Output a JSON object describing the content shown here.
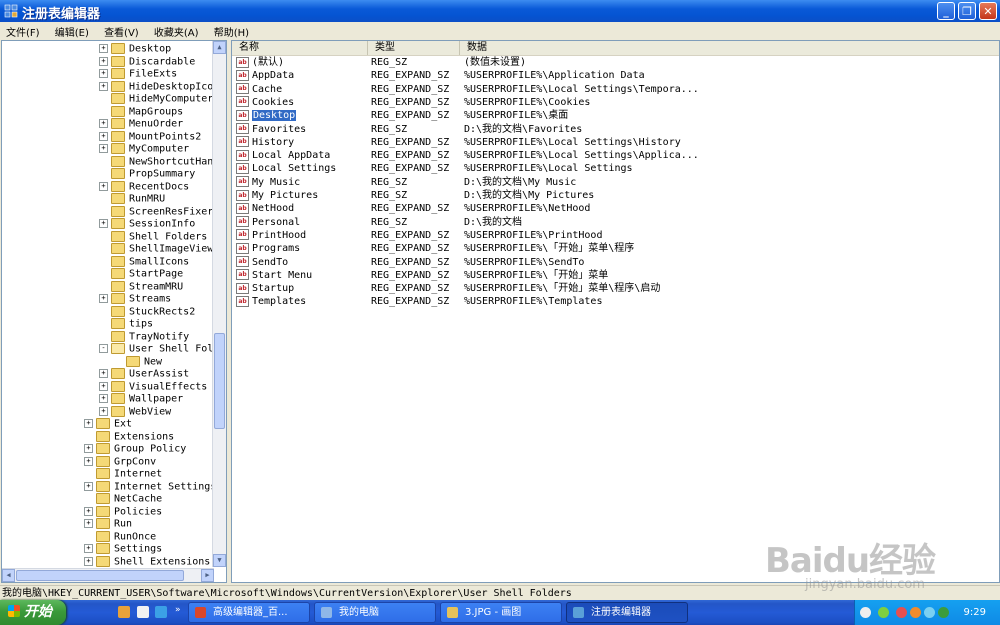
{
  "window": {
    "title": "注册表编辑器"
  },
  "menu": [
    "文件(F)",
    "编辑(E)",
    "查看(V)",
    "收藏夹(A)",
    "帮助(H)"
  ],
  "tree": {
    "items": [
      {
        "label": "Desktop",
        "level": 2,
        "expander": "+"
      },
      {
        "label": "Discardable",
        "level": 2,
        "expander": "+"
      },
      {
        "label": "FileExts",
        "level": 2,
        "expander": "+"
      },
      {
        "label": "HideDesktopIcons",
        "level": 2,
        "expander": "+"
      },
      {
        "label": "HideMyComputerIcons",
        "level": 2,
        "expander": ""
      },
      {
        "label": "MapGroups",
        "level": 2,
        "expander": ""
      },
      {
        "label": "MenuOrder",
        "level": 2,
        "expander": "+"
      },
      {
        "label": "MountPoints2",
        "level": 2,
        "expander": "+"
      },
      {
        "label": "MyComputer",
        "level": 2,
        "expander": "+"
      },
      {
        "label": "NewShortcutHandlers",
        "level": 2,
        "expander": ""
      },
      {
        "label": "PropSummary",
        "level": 2,
        "expander": ""
      },
      {
        "label": "RecentDocs",
        "level": 2,
        "expander": "+"
      },
      {
        "label": "RunMRU",
        "level": 2,
        "expander": ""
      },
      {
        "label": "ScreenResFixer",
        "level": 2,
        "expander": ""
      },
      {
        "label": "SessionInfo",
        "level": 2,
        "expander": "+"
      },
      {
        "label": "Shell Folders",
        "level": 2,
        "expander": ""
      },
      {
        "label": "ShellImageView",
        "level": 2,
        "expander": ""
      },
      {
        "label": "SmallIcons",
        "level": 2,
        "expander": ""
      },
      {
        "label": "StartPage",
        "level": 2,
        "expander": ""
      },
      {
        "label": "StreamMRU",
        "level": 2,
        "expander": ""
      },
      {
        "label": "Streams",
        "level": 2,
        "expander": "+"
      },
      {
        "label": "StuckRects2",
        "level": 2,
        "expander": ""
      },
      {
        "label": "tips",
        "level": 2,
        "expander": ""
      },
      {
        "label": "TrayNotify",
        "level": 2,
        "expander": ""
      },
      {
        "label": "User Shell Folders",
        "level": 2,
        "expander": "-",
        "open": true
      },
      {
        "label": "New",
        "level": 3,
        "expander": ""
      },
      {
        "label": "UserAssist",
        "level": 2,
        "expander": "+"
      },
      {
        "label": "VisualEffects",
        "level": 2,
        "expander": "+"
      },
      {
        "label": "Wallpaper",
        "level": 2,
        "expander": "+"
      },
      {
        "label": "WebView",
        "level": 2,
        "expander": "+"
      },
      {
        "label": "Ext",
        "level": 1,
        "expander": "+"
      },
      {
        "label": "Extensions",
        "level": 1,
        "expander": ""
      },
      {
        "label": "Group Policy",
        "level": 1,
        "expander": "+"
      },
      {
        "label": "GrpConv",
        "level": 1,
        "expander": "+"
      },
      {
        "label": "Internet",
        "level": 1,
        "expander": ""
      },
      {
        "label": "Internet Settings",
        "level": 1,
        "expander": "+"
      },
      {
        "label": "NetCache",
        "level": 1,
        "expander": ""
      },
      {
        "label": "Policies",
        "level": 1,
        "expander": "+"
      },
      {
        "label": "Run",
        "level": 1,
        "expander": "+"
      },
      {
        "label": "RunOnce",
        "level": 1,
        "expander": ""
      },
      {
        "label": "Settings",
        "level": 1,
        "expander": "+"
      },
      {
        "label": "Shell Extensions",
        "level": 1,
        "expander": "+"
      }
    ]
  },
  "list": {
    "columns": [
      "名称",
      "类型",
      "数据"
    ],
    "rows": [
      {
        "name": "(默认)",
        "type": "REG_SZ",
        "data": "(数值未设置)"
      },
      {
        "name": "AppData",
        "type": "REG_EXPAND_SZ",
        "data": "%USERPROFILE%\\Application Data"
      },
      {
        "name": "Cache",
        "type": "REG_EXPAND_SZ",
        "data": "%USERPROFILE%\\Local Settings\\Tempora..."
      },
      {
        "name": "Cookies",
        "type": "REG_EXPAND_SZ",
        "data": "%USERPROFILE%\\Cookies"
      },
      {
        "name": "Desktop",
        "type": "REG_EXPAND_SZ",
        "data": "%USERPROFILE%\\桌面",
        "selected": true
      },
      {
        "name": "Favorites",
        "type": "REG_SZ",
        "data": "D:\\我的文档\\Favorites"
      },
      {
        "name": "History",
        "type": "REG_EXPAND_SZ",
        "data": "%USERPROFILE%\\Local Settings\\History"
      },
      {
        "name": "Local AppData",
        "type": "REG_EXPAND_SZ",
        "data": "%USERPROFILE%\\Local Settings\\Applica..."
      },
      {
        "name": "Local Settings",
        "type": "REG_EXPAND_SZ",
        "data": "%USERPROFILE%\\Local Settings"
      },
      {
        "name": "My Music",
        "type": "REG_SZ",
        "data": "D:\\我的文档\\My Music"
      },
      {
        "name": "My Pictures",
        "type": "REG_SZ",
        "data": "D:\\我的文档\\My Pictures"
      },
      {
        "name": "NetHood",
        "type": "REG_EXPAND_SZ",
        "data": "%USERPROFILE%\\NetHood"
      },
      {
        "name": "Personal",
        "type": "REG_SZ",
        "data": "D:\\我的文档"
      },
      {
        "name": "PrintHood",
        "type": "REG_EXPAND_SZ",
        "data": "%USERPROFILE%\\PrintHood"
      },
      {
        "name": "Programs",
        "type": "REG_EXPAND_SZ",
        "data": "%USERPROFILE%\\「开始」菜单\\程序"
      },
      {
        "name": "SendTo",
        "type": "REG_EXPAND_SZ",
        "data": "%USERPROFILE%\\SendTo"
      },
      {
        "name": "Start Menu",
        "type": "REG_EXPAND_SZ",
        "data": "%USERPROFILE%\\「开始」菜单"
      },
      {
        "name": "Startup",
        "type": "REG_EXPAND_SZ",
        "data": "%USERPROFILE%\\「开始」菜单\\程序\\启动"
      },
      {
        "name": "Templates",
        "type": "REG_EXPAND_SZ",
        "data": "%USERPROFILE%\\Templates"
      }
    ]
  },
  "status": {
    "path": "我的电脑\\HKEY_CURRENT_USER\\Software\\Microsoft\\Windows\\CurrentVersion\\Explorer\\User Shell Folders"
  },
  "taskbar": {
    "start_label": "开始",
    "buttons": [
      {
        "label": "高级编辑器_百...",
        "icon_color": "#d9472b"
      },
      {
        "label": "我的电脑",
        "icon_color": "#8fb7e8"
      },
      {
        "label": "3.JPG - 画图",
        "icon_color": "#e6c25a"
      },
      {
        "label": "注册表编辑器",
        "icon_color": "#5aa0d8",
        "active": true
      }
    ],
    "clock": "9:29"
  },
  "watermark": {
    "brand": "Baidu经验",
    "url": "jingyan.baidu.com"
  }
}
